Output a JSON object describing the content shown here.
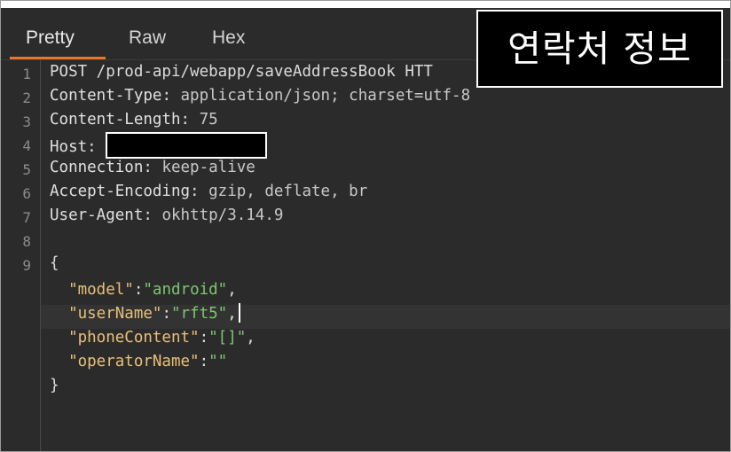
{
  "tabs": [
    {
      "label": "Pretty",
      "active": true
    },
    {
      "label": "Raw",
      "active": false
    },
    {
      "label": "Hex",
      "active": false
    }
  ],
  "overlay_label": "연락처 정보",
  "line_numbers": [
    "1",
    "2",
    "3",
    "4",
    "5",
    "6",
    "7",
    "8",
    "9"
  ],
  "request": {
    "request_line": "POST /prod-api/webapp/saveAddressBook HTT",
    "headers": [
      {
        "name": "Content-Type",
        "value": "application/json; charset=utf-8"
      },
      {
        "name": "Content-Length",
        "value": "75"
      },
      {
        "name": "Host",
        "value": ""
      },
      {
        "name": "Connection",
        "value": "keep-alive"
      },
      {
        "name": "Accept-Encoding",
        "value": "gzip, deflate, br"
      },
      {
        "name": "User-Agent",
        "value": "okhttp/3.14.9"
      }
    ],
    "body": {
      "open_brace": "{",
      "close_brace": "}",
      "fields": [
        {
          "key": "\"model\"",
          "value": "\"android\"",
          "trail": ","
        },
        {
          "key": "\"userName\"",
          "value": "\"rft5\"",
          "trail": ","
        },
        {
          "key": "\"phoneContent\"",
          "value": "\"[]\"",
          "trail": ","
        },
        {
          "key": "\"operatorName\"",
          "value": "\"\"",
          "trail": ""
        }
      ]
    }
  },
  "colors": {
    "accent_tab": "#e8762d",
    "json_key": "#e8c07a",
    "json_value": "#7cc76f"
  }
}
